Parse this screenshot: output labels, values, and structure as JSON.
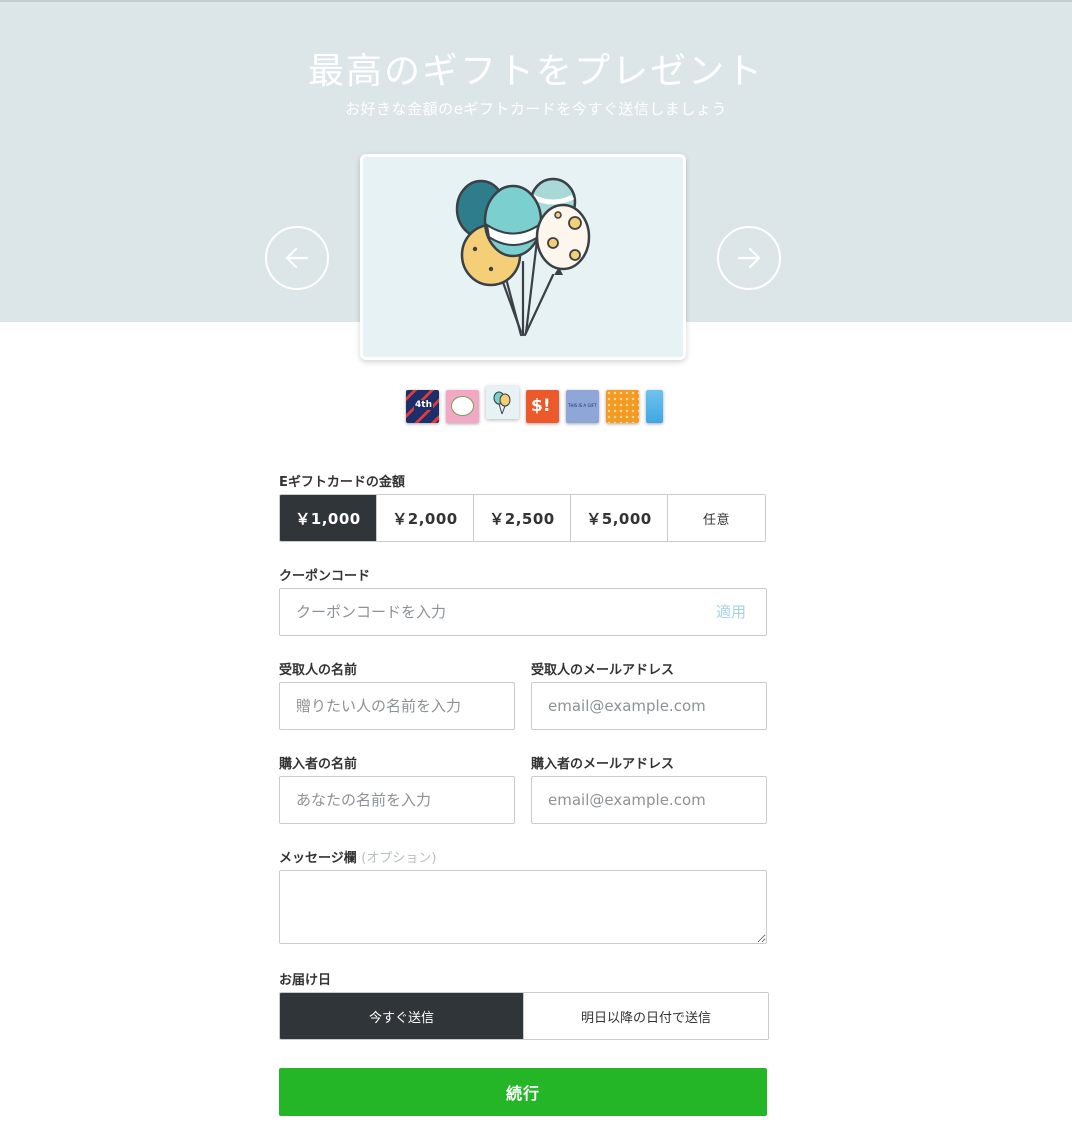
{
  "hero": {
    "title": "最高のギフトをプレゼント",
    "subtitle": "お好きな金額のeギフトカードを今すぐ送信しましょう"
  },
  "carousel": {
    "selected_index": 2,
    "thumbnails": [
      {
        "name": "happy-4th-of-july",
        "text": "4th"
      },
      {
        "name": "flower-card"
      },
      {
        "name": "balloons-card"
      },
      {
        "name": "dollar-card",
        "text": "$!"
      },
      {
        "name": "this-is-a-gift-card",
        "text": "THIS IS A GIFT"
      },
      {
        "name": "orange-dots-card"
      },
      {
        "name": "blue-card"
      }
    ]
  },
  "amount": {
    "label": "Eギフトカードの金額",
    "options": [
      "￥1,000",
      "￥2,000",
      "￥2,500",
      "￥5,000",
      "任意"
    ],
    "selected": "￥1,000"
  },
  "coupon": {
    "label": "クーポンコード",
    "placeholder": "クーポンコードを入力",
    "value": "",
    "apply_label": "適用"
  },
  "recipient": {
    "name_label": "受取人の名前",
    "name_placeholder": "贈りたい人の名前を入力",
    "email_label": "受取人のメールアドレス",
    "email_placeholder": "email@example.com"
  },
  "purchaser": {
    "name_label": "購入者の名前",
    "name_placeholder": "あなたの名前を入力",
    "email_label": "購入者のメールアドレス",
    "email_placeholder": "email@example.com"
  },
  "message": {
    "label": "メッセージ欄",
    "optional": "(オプション)",
    "value": ""
  },
  "delivery": {
    "label": "お届け日",
    "options": [
      "今すぐ送信",
      "明日以降の日付で送信"
    ],
    "selected": "今すぐ送信"
  },
  "continue_label": "続行",
  "colors": {
    "hero_bg": "#dce6e8",
    "selected_bg": "#30353a",
    "continue_bg": "#25b627",
    "apply_link": "#a6d3e4"
  }
}
